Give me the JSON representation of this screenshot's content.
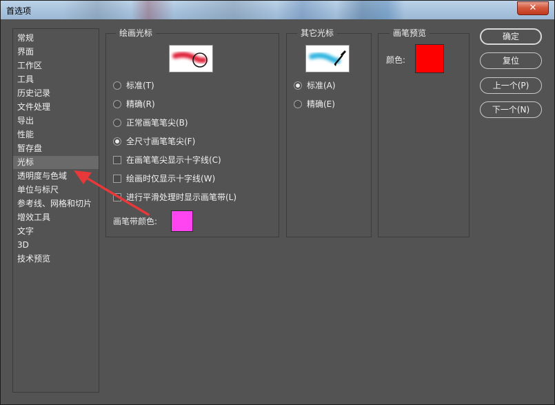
{
  "window": {
    "title": "首选项",
    "close_glyph": "✕"
  },
  "nav": {
    "selected_index": 9,
    "items": [
      "常规",
      "界面",
      "工作区",
      "工具",
      "历史记录",
      "文件处理",
      "导出",
      "性能",
      "暂存盘",
      "光标",
      "透明度与色域",
      "单位与标尺",
      "参考线、网格和切片",
      "增效工具",
      "文字",
      "3D",
      "技术预览"
    ]
  },
  "painting_cursors": {
    "legend": "绘画光标",
    "preview_icon": "brush-circle-cursor-icon",
    "options": [
      {
        "label": "标准(T)",
        "type": "radio",
        "checked": false
      },
      {
        "label": "精确(R)",
        "type": "radio",
        "checked": false
      },
      {
        "label": "正常画笔笔尖(B)",
        "type": "radio",
        "checked": false
      },
      {
        "label": "全尺寸画笔笔尖(F)",
        "type": "radio",
        "checked": true
      },
      {
        "label": "在画笔笔尖显示十字线(C)",
        "type": "checkbox",
        "checked": false
      },
      {
        "label": "绘画时仅显示十字线(W)",
        "type": "checkbox",
        "checked": false
      },
      {
        "label": "进行平滑处理时显示画笔带(L)",
        "type": "checkbox",
        "checked": false
      }
    ],
    "leash_color_label": "画笔带颜色:",
    "leash_color": "#ff44f1"
  },
  "other_cursors": {
    "legend": "其它光标",
    "preview_icon": "eyedropper-cursor-icon",
    "options": [
      {
        "label": "标准(A)",
        "type": "radio",
        "checked": true
      },
      {
        "label": "精确(E)",
        "type": "radio",
        "checked": false
      }
    ]
  },
  "brush_preview": {
    "legend": "画笔预览",
    "color_label": "颜色:",
    "color": "#ff0000"
  },
  "buttons": {
    "ok": "确定",
    "reset": "复位",
    "prev": "上一个(P)",
    "next": "下一个(N)"
  },
  "colors": {
    "panel": "#535353",
    "annotation_arrow": "#e8383a",
    "stroke_red": "#e0203a",
    "stroke_cyan": "#35b6e0"
  }
}
